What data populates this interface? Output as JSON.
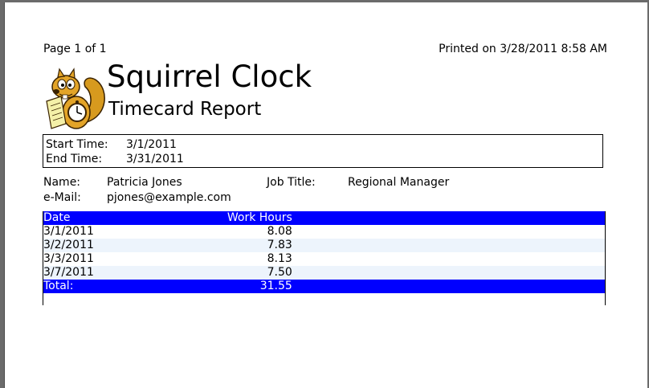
{
  "header": {
    "page_label": "Page 1 of 1",
    "printed_label": "Printed on 3/28/2011 8:58 AM"
  },
  "brand": {
    "title": "Squirrel Clock",
    "subtitle": "Timecard Report",
    "logo_icon": "squirrel-with-clock-icon"
  },
  "range": {
    "start_label": "Start Time:",
    "start_value": "3/1/2011",
    "end_label": "End Time:",
    "end_value": "3/31/2011"
  },
  "employee": {
    "name_label": "Name:",
    "name_value": "Patricia Jones",
    "email_label": "e-Mail:",
    "email_value": "pjones@example.com",
    "job_label": "Job Title:",
    "job_value": "Regional Manager"
  },
  "table": {
    "columns": [
      "Date",
      "Work Hours"
    ],
    "rows": [
      {
        "date": "3/1/2011",
        "hours": "8.08"
      },
      {
        "date": "3/2/2011",
        "hours": "7.83"
      },
      {
        "date": "3/3/2011",
        "hours": "8.13"
      },
      {
        "date": "3/7/2011",
        "hours": "7.50"
      }
    ],
    "total_label": "Total:",
    "total_value": "31.55"
  },
  "colors": {
    "header_bg": "#0000ff",
    "alt_row_bg": "#edf4fc",
    "viewer_bg": "#6b6b6b"
  }
}
